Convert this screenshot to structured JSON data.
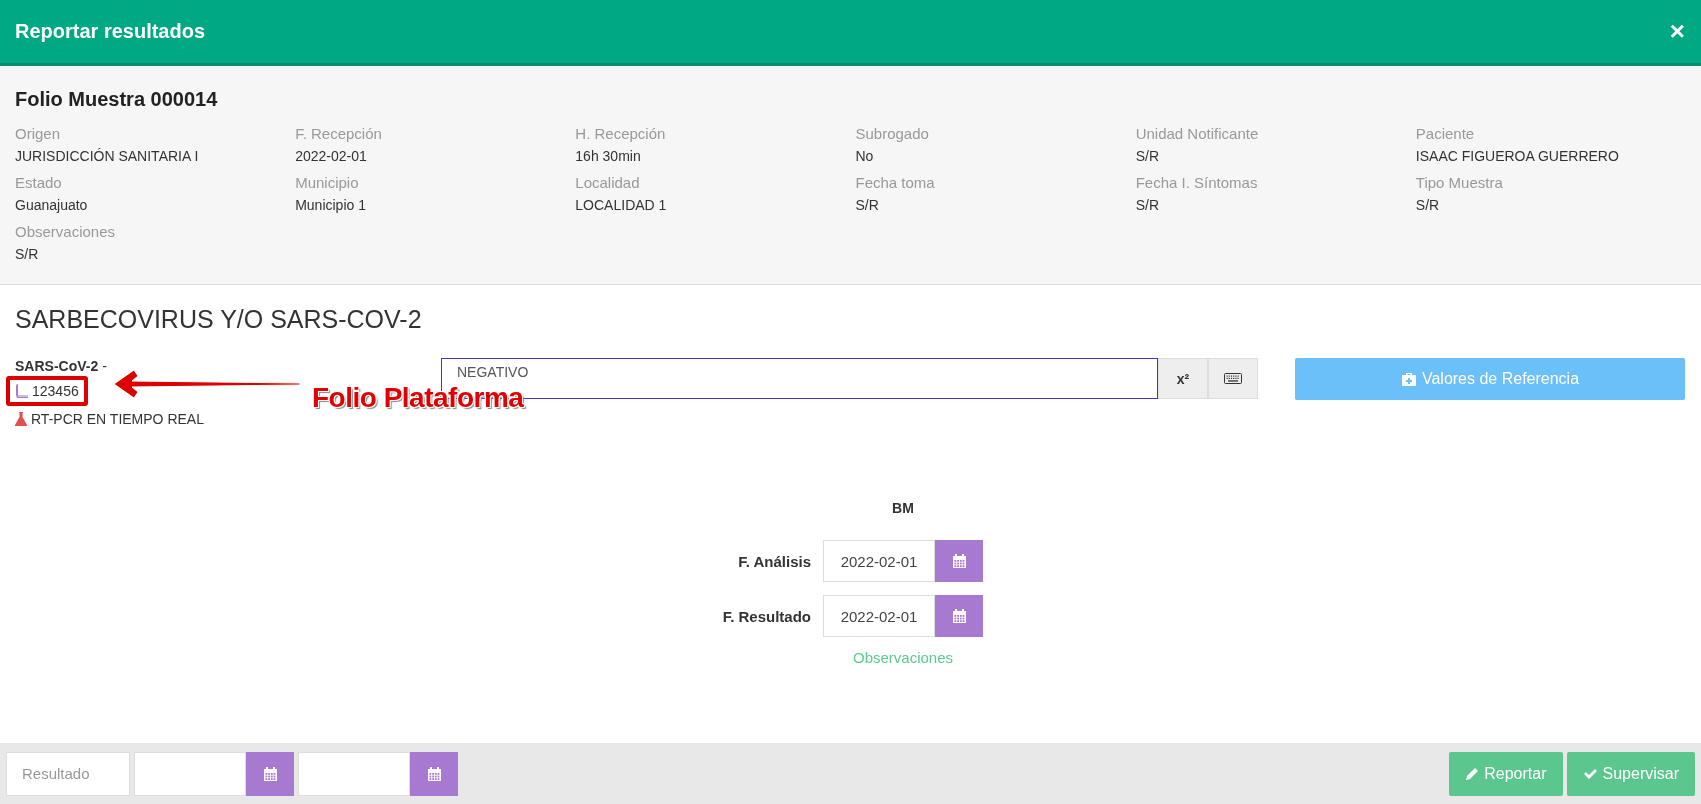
{
  "modal": {
    "title": "Reportar resultados",
    "close": "×"
  },
  "sample": {
    "title": "Folio Muestra 000014",
    "fields": [
      {
        "label": "Origen",
        "value": "JURISDICCIÓN SANITARIA I"
      },
      {
        "label": "F. Recepción",
        "value": "2022-02-01"
      },
      {
        "label": "H. Recepción",
        "value": "16h 30min"
      },
      {
        "label": "Subrogado",
        "value": "No"
      },
      {
        "label": "Unidad Notificante",
        "value": "S/R"
      },
      {
        "label": "Paciente",
        "value": "ISAAC FIGUEROA GUERRERO"
      },
      {
        "label": "Estado",
        "value": "Guanajuato"
      },
      {
        "label": "Municipio",
        "value": "Municipio 1"
      },
      {
        "label": "Localidad",
        "value": "LOCALIDAD 1"
      },
      {
        "label": "Fecha toma",
        "value": "S/R"
      },
      {
        "label": "Fecha I. Síntomas",
        "value": "S/R"
      },
      {
        "label": "Tipo Muestra",
        "value": "S/R"
      },
      {
        "label": "Observaciones",
        "value": "S/R"
      }
    ]
  },
  "test": {
    "title": "SARBECOVIRUS Y/O SARS-COV-2",
    "analyte": "SARS-CoV-2",
    "separator": "-",
    "folio": "123456",
    "method": "RT-PCR EN TIEMPO REAL",
    "result": "NEGATIVO",
    "superscript_button": "x²",
    "reference_button": "Valores de Referencia"
  },
  "annotation": {
    "text": "Folio Plataforma"
  },
  "dates": {
    "heading": "BM",
    "rows": [
      {
        "label": "F. Análisis",
        "value": "2022-02-01"
      },
      {
        "label": "F. Resultado",
        "value": "2022-02-01"
      }
    ],
    "link": "Observaciones"
  },
  "footer": {
    "result_placeholder": "Resultado",
    "buttons": [
      {
        "label": "Reportar",
        "kind": "edit"
      },
      {
        "label": "Supervisar",
        "kind": "check"
      }
    ]
  }
}
